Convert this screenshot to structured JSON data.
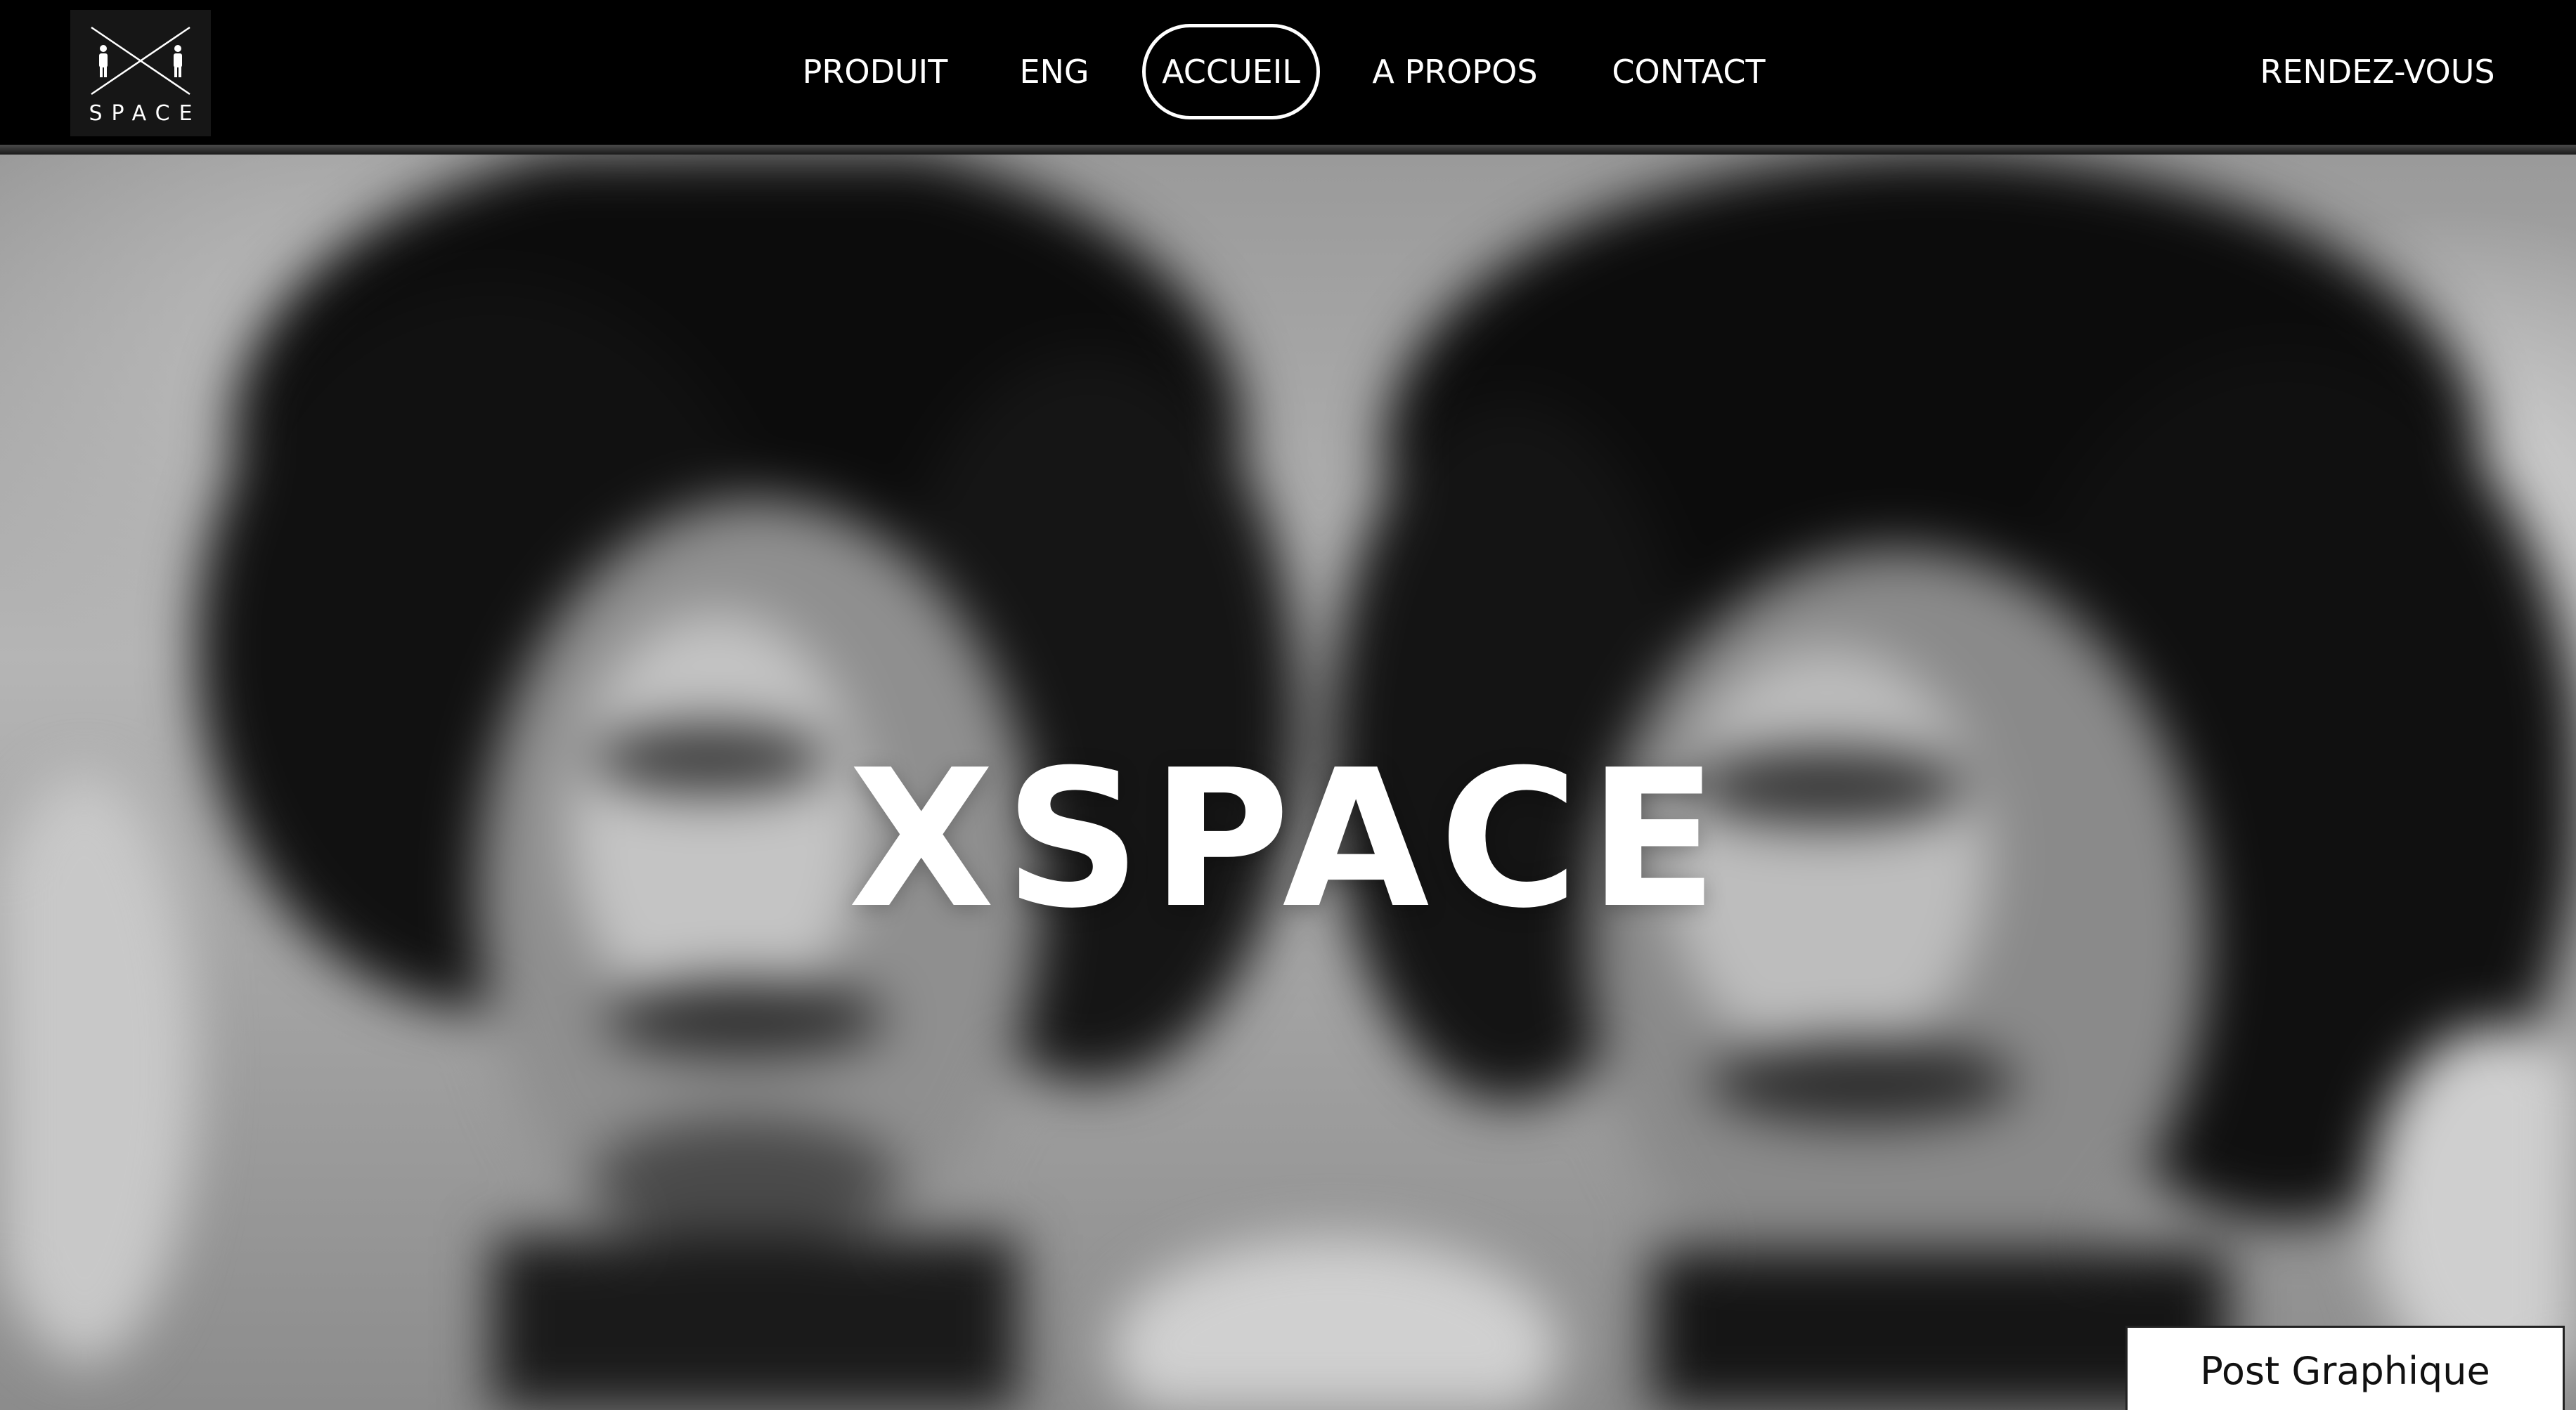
{
  "header": {
    "logo": {
      "icon": "xspace-logo-icon",
      "text": "SPACE"
    },
    "nav": [
      {
        "label": "PRODUIT",
        "active": false
      },
      {
        "label": "ENG",
        "active": false
      },
      {
        "label": "ACCUEIL",
        "active": true
      },
      {
        "label": "A PROPOS",
        "active": false
      },
      {
        "label": "CONTACT",
        "active": false
      }
    ],
    "cta_label": "RENDEZ-VOUS"
  },
  "hero": {
    "title": "XSPACE",
    "image": "blurred-black-and-white-photo-two-people"
  },
  "post_box": {
    "label": "Post Graphique"
  },
  "colors": {
    "header_bg": "#000000",
    "text": "#ffffff",
    "hero_tone": "grayscale"
  }
}
